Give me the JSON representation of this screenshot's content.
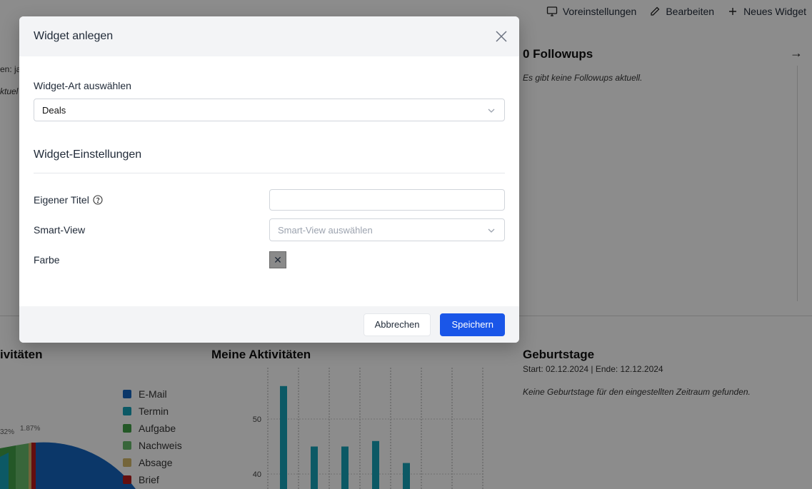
{
  "header_actions": {
    "presets": "Voreinstellungen",
    "edit": "Bearbeiten",
    "new_widget": "Neues Widget"
  },
  "background": {
    "left_fragment_1": "en: ja",
    "left_fragment_2": "ktuel",
    "followups": {
      "title": "0 Followups",
      "empty": "Es gibt keine Followups aktuell."
    },
    "activities_left": {
      "title": "ivitäten"
    },
    "my_activities": {
      "title": "Meine Aktivitäten"
    },
    "birthdays": {
      "title": "Geburtstage",
      "subtitle": "Start: 02.12.2024 | Ende: 12.12.2024",
      "empty": "Keine Geburtstage für den eingestellten Zeitraum gefunden."
    },
    "legend": [
      {
        "label": "E-Mail",
        "color": "#1565c0"
      },
      {
        "label": "Termin",
        "color": "#17a2b8"
      },
      {
        "label": "Aufgabe",
        "color": "#43a047"
      },
      {
        "label": "Nachweis",
        "color": "#66bb6a"
      },
      {
        "label": "Absage",
        "color": "#d4b96a"
      },
      {
        "label": "Brief",
        "color": "#b71c1c"
      }
    ],
    "pie_labels": [
      "32%",
      "1.87%"
    ]
  },
  "chart_data": {
    "type": "bar",
    "title": "Meine Aktivitäten",
    "yticks": [
      40,
      50
    ],
    "values": [
      56,
      45,
      45,
      46,
      42
    ],
    "ylim": [
      35,
      60
    ]
  },
  "modal": {
    "title": "Widget anlegen",
    "widget_type_label": "Widget-Art auswählen",
    "widget_type_value": "Deals",
    "settings_title": "Widget-Einstellungen",
    "own_title_label": "Eigener Titel",
    "own_title_value": "",
    "smartview_label": "Smart-View",
    "smartview_placeholder": "Smart-View auswählen",
    "color_label": "Farbe",
    "color_value": "#8a8a8a",
    "cancel": "Abbrechen",
    "save": "Speichern"
  }
}
